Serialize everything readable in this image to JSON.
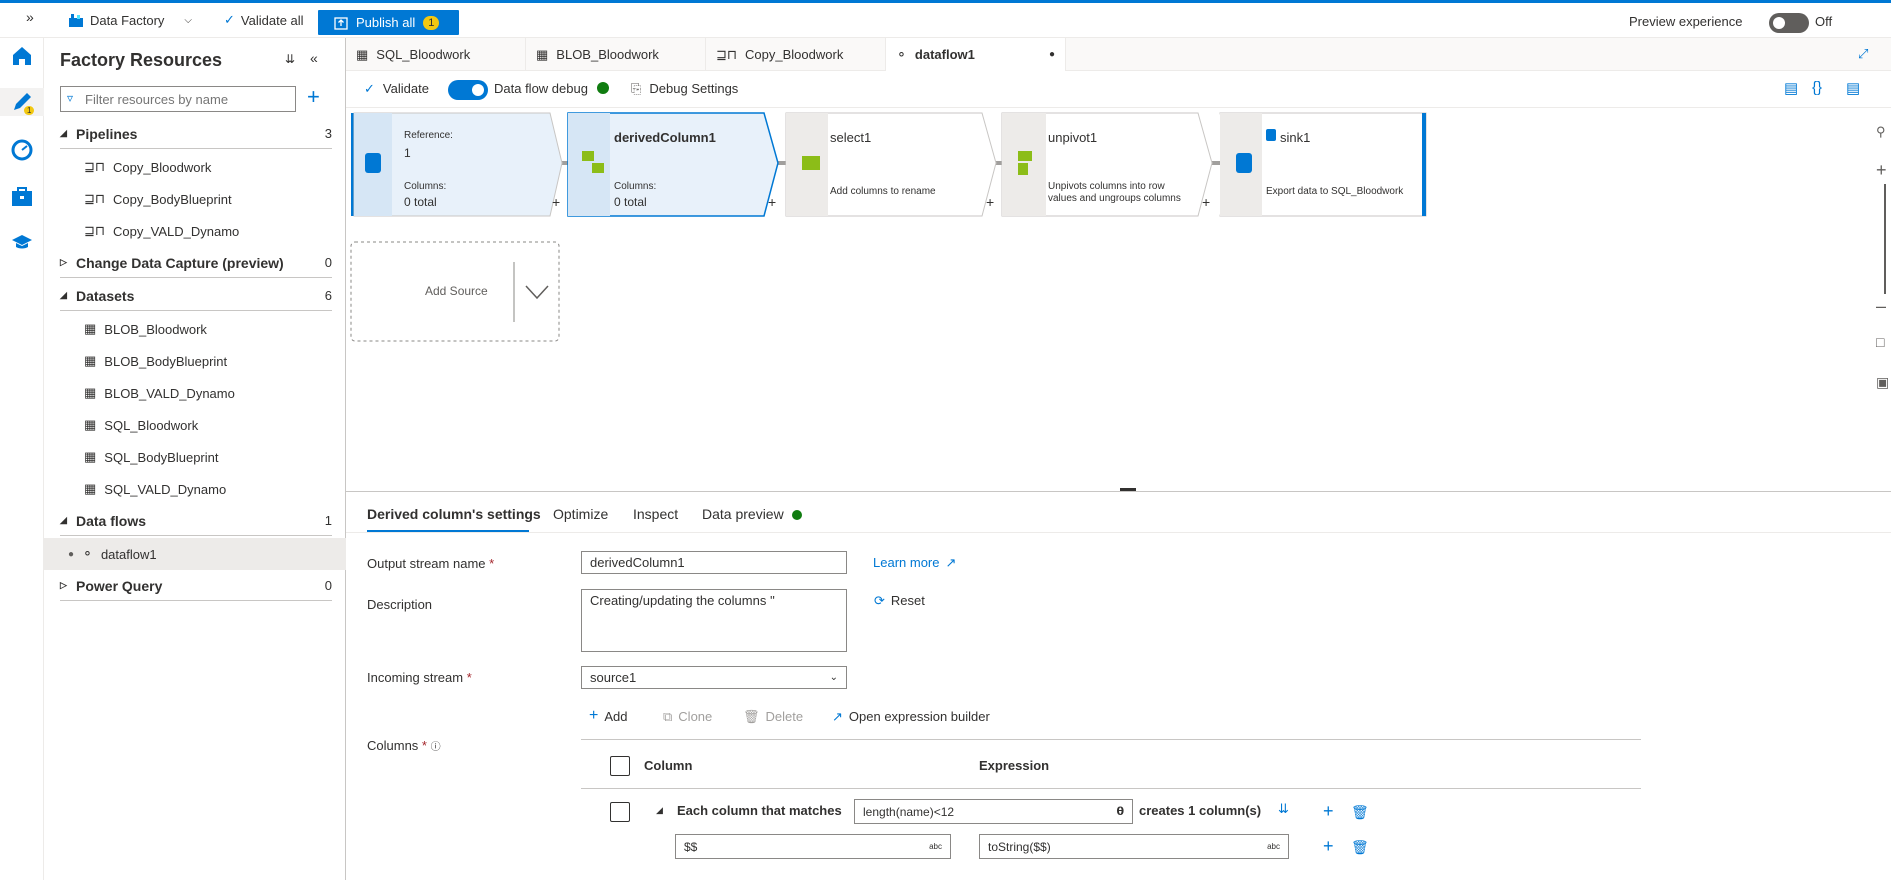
{
  "topbar": {
    "factory_label": "Data Factory",
    "validate_all": "Validate all",
    "publish_all": "Publish all",
    "publish_count": "1",
    "preview_experience": "Preview experience",
    "preview_state": "Off"
  },
  "rail": {
    "author_badge": "1"
  },
  "resources": {
    "title": "Factory Resources",
    "filter_placeholder": "Filter resources by name",
    "sections": {
      "pipelines": {
        "label": "Pipelines",
        "count": "3",
        "items": [
          "Copy_Bloodwork",
          "Copy_BodyBlueprint",
          "Copy_VALD_Dynamo"
        ]
      },
      "cdc": {
        "label": "Change Data Capture (preview)",
        "count": "0"
      },
      "datasets": {
        "label": "Datasets",
        "count": "6",
        "items": [
          "BLOB_Bloodwork",
          "BLOB_BodyBlueprint",
          "BLOB_VALD_Dynamo",
          "SQL_Bloodwork",
          "SQL_BodyBlueprint",
          "SQL_VALD_Dynamo"
        ]
      },
      "dataflows": {
        "label": "Data flows",
        "count": "1",
        "items": [
          "dataflow1"
        ]
      },
      "powerquery": {
        "label": "Power Query",
        "count": "0"
      }
    }
  },
  "tabs": [
    "SQL_Bloodwork",
    "BLOB_Bloodwork",
    "Copy_Bloodwork",
    "dataflow1"
  ],
  "canvas_toolbar": {
    "validate": "Validate",
    "debug_label": "Data flow debug",
    "debug_settings": "Debug Settings"
  },
  "flow": {
    "source": {
      "ref_label": "Reference:",
      "ref_value": "1",
      "cols_label": "Columns:",
      "cols_value": "0 total"
    },
    "derived": {
      "title": "derivedColumn1",
      "cols_label": "Columns:",
      "cols_value": "0 total"
    },
    "select": {
      "title": "select1",
      "desc": "Add columns to rename"
    },
    "unpivot": {
      "title": "unpivot1",
      "desc1": "Unpivots columns into row",
      "desc2": "values and ungroups columns"
    },
    "sink": {
      "title": "sink1",
      "desc": "Export data to SQL_Bloodwork"
    },
    "add_source": "Add Source",
    "plus": "+"
  },
  "settings": {
    "tabs": [
      "Derived column's settings",
      "Optimize",
      "Inspect",
      "Data preview"
    ],
    "output_stream_label": "Output stream name",
    "output_stream_value": "derivedColumn1",
    "learn_more": "Learn more",
    "description_label": "Description",
    "description_value": "Creating/updating the columns ''",
    "reset": "Reset",
    "incoming_label": "Incoming stream",
    "incoming_value": "source1",
    "add": "Add",
    "clone": "Clone",
    "delete": "Delete",
    "open_builder": "Open expression builder",
    "columns_label": "Columns",
    "col_header": "Column",
    "expr_header": "Expression",
    "pattern_label": "Each column that matches",
    "pattern_value": "length(name)<12",
    "creates_label": "creates 1 column(s)",
    "row_column": "$$",
    "row_expression": "toString($$)",
    "abc": "abc"
  },
  "colors": {
    "accent": "#0078d4",
    "badge": "#f2c811",
    "status_green": "#107c10",
    "required": "#a4262c"
  }
}
